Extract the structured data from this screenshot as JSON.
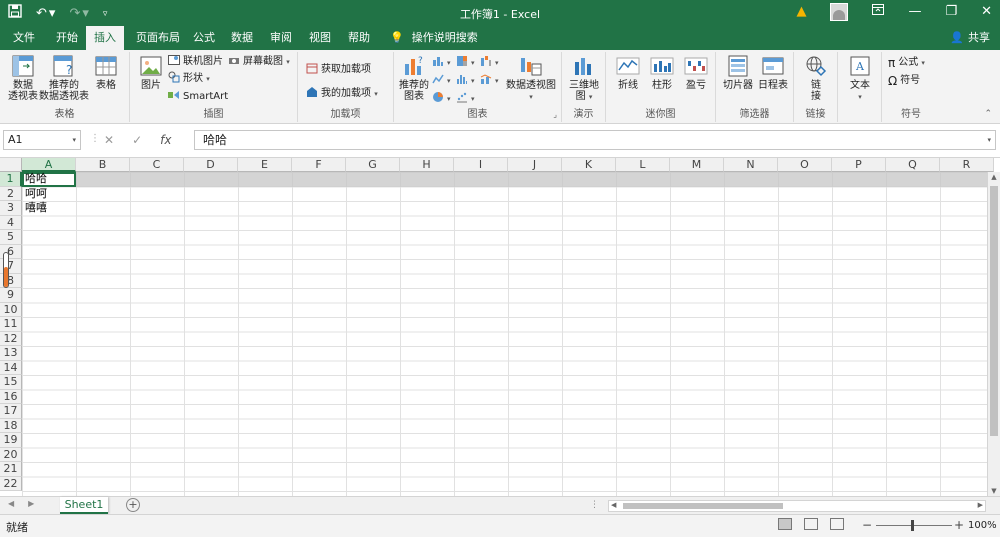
{
  "window": {
    "title": "工作簿1 - Excel"
  },
  "ribbon_tabs": {
    "file": "文件",
    "home": "开始",
    "insert": "插入",
    "page_layout": "页面布局",
    "formulas": "公式",
    "data": "数据",
    "review": "审阅",
    "view": "视图",
    "help": "帮助",
    "tell_me": "操作说明搜索",
    "share": "共享",
    "active": "插入"
  },
  "groups": {
    "tables": {
      "label": "表格",
      "pivot_table_line1": "数据",
      "pivot_table_line2": "透视表",
      "recommended_pivot_line1": "推荐的",
      "recommended_pivot_line2": "数据透视表",
      "table": "表格"
    },
    "illustrations": {
      "label": "插图",
      "pictures": "图片",
      "online_pictures": "联机图片",
      "shapes": "形状",
      "smartart": "SmartArt",
      "screenshot": "屏幕截图"
    },
    "addins": {
      "label": "加载项",
      "get_addins": "获取加载项",
      "my_addins": "我的加载项"
    },
    "charts": {
      "label": "图表",
      "recommended_line1": "推荐的",
      "recommended_line2": "图表",
      "pivot_chart": "数据透视图"
    },
    "tours": {
      "label": "演示",
      "map3d_line1": "三维地",
      "map3d_line2": "图"
    },
    "sparklines": {
      "label": "迷你图",
      "line": "折线",
      "column": "柱形",
      "winloss": "盈亏"
    },
    "filters": {
      "label": "筛选器",
      "slicer": "切片器",
      "timeline": "日程表"
    },
    "links": {
      "label": "链接",
      "link_line1": "链",
      "link_line2": "接"
    },
    "text": {
      "label": "",
      "text": "文本"
    },
    "symbols": {
      "label": "符号",
      "equation": "公式",
      "symbol": "符号"
    }
  },
  "formula_bar": {
    "name_box": "A1",
    "fx": "fx",
    "content": "哈哈"
  },
  "columns": [
    "A",
    "B",
    "C",
    "D",
    "E",
    "F",
    "G",
    "H",
    "I",
    "J",
    "K",
    "L",
    "M",
    "N",
    "O",
    "P",
    "Q",
    "R"
  ],
  "rows": [
    "1",
    "2",
    "3",
    "4",
    "5",
    "6",
    "7",
    "8",
    "9",
    "10",
    "11",
    "12",
    "13",
    "14",
    "15",
    "16",
    "17",
    "18",
    "19",
    "20",
    "21",
    "22"
  ],
  "cells": {
    "A1": "哈哈",
    "A2": "呵呵",
    "A3": "嘻嘻"
  },
  "sheets": {
    "active": "Sheet1"
  },
  "status": {
    "ready": "就绪",
    "zoom": "100%"
  },
  "colors": {
    "excel_green": "#217346",
    "selection_band": "#c6c6c6"
  },
  "icons": {
    "save": "save-icon",
    "undo": "undo-icon",
    "redo": "redo-icon",
    "warning": "warning-icon",
    "lightbulb": "lightbulb-icon"
  }
}
